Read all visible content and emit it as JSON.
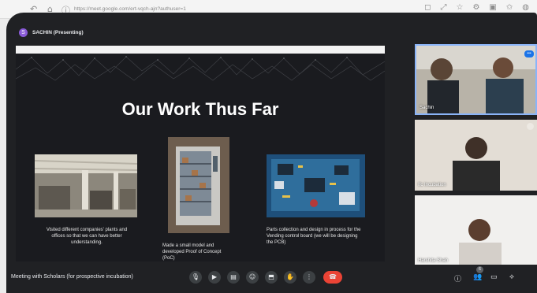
{
  "browser": {
    "url": "https://meet.google.com/ert-vqch-ajn?authuser=1"
  },
  "presenter": {
    "initial": "S",
    "label": "SACHIN (Presenting)"
  },
  "slide": {
    "title": "Our Work Thus Far",
    "captions": [
      "Visited different companies' plants and offices so that we can have better understanding.",
      "Made a small model and developed Proof of Concept (PoC)",
      "Parts collection and design in process for the Vending control board (we will be designing the PCB)"
    ]
  },
  "participants": [
    {
      "name": "Sachin"
    },
    {
      "name": "Ifc Incubation"
    },
    {
      "name": "Harshita Shah"
    }
  ],
  "bottom_bar": {
    "meeting_title": "Meeting with Scholars (for prospective incubation)",
    "people_count": "6"
  },
  "icons": {
    "controls": [
      "mic-icon",
      "camera-icon",
      "captions-icon",
      "emoji-icon",
      "present-icon",
      "raise-hand-icon",
      "more-options-icon",
      "end-call-icon"
    ],
    "right": [
      "info-icon",
      "people-icon",
      "chat-icon",
      "activities-icon"
    ]
  },
  "colors": {
    "accent": "#1a73e8",
    "end_call": "#ea4335",
    "background": "#202124"
  }
}
